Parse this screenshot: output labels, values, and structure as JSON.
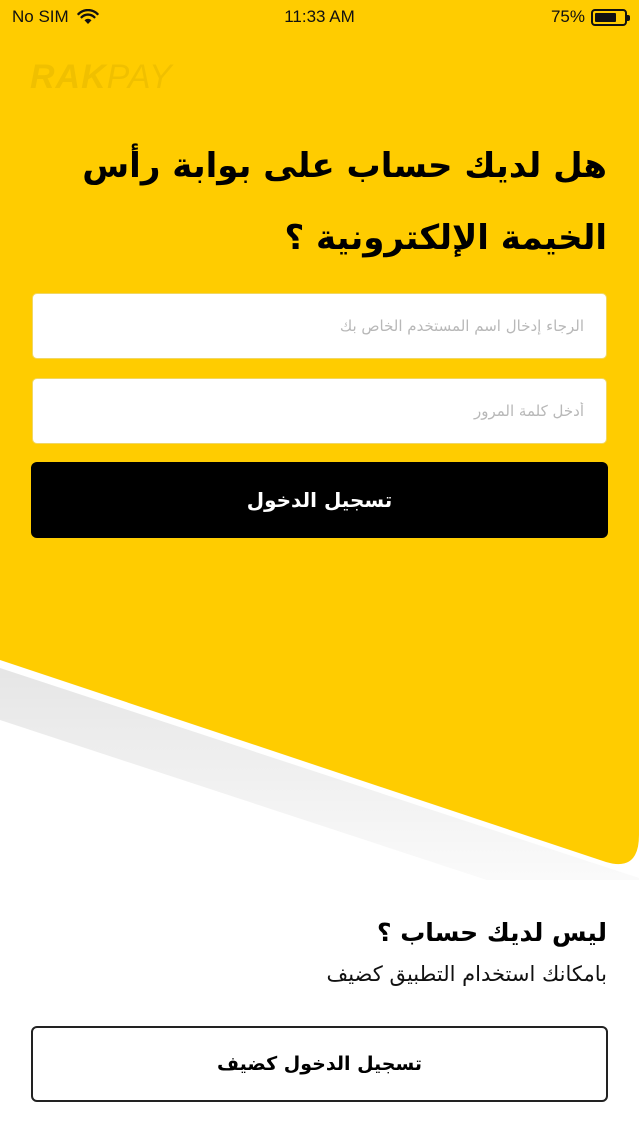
{
  "status_bar": {
    "carrier": "No SIM",
    "time": "11:33 AM",
    "battery_percent": "75%",
    "battery_level": 0.75
  },
  "brand": {
    "logo_part1": "RAK",
    "logo_part2": "PAY"
  },
  "login": {
    "title": "هل لديك حساب على بوابة رأس الخيمة الإلكترونية ؟",
    "username_placeholder": "الرجاء إدخال اسم المستخدم الخاص بك",
    "password_placeholder": "أدخل كلمة المرور",
    "submit_label": "تسجيل الدخول"
  },
  "guest": {
    "title": "ليس لديك حساب ؟",
    "subtitle": "بامكانك استخدام التطبيق كضيف",
    "button_label": "تسجيل الدخول كضيف"
  },
  "colors": {
    "accent_yellow": "#FFCC00",
    "button_dark": "#000000",
    "background": "#FFFFFF"
  }
}
